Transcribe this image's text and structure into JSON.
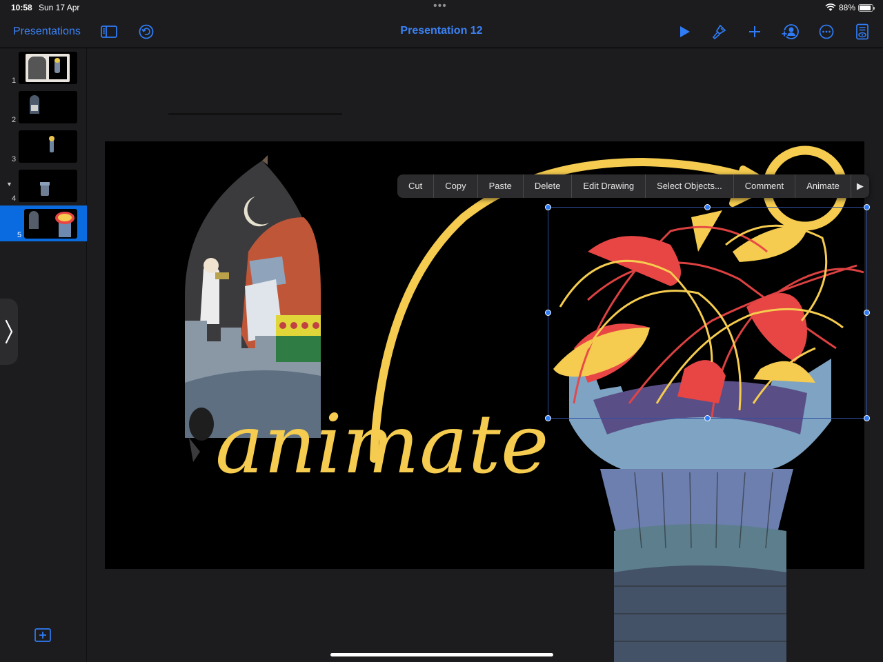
{
  "status": {
    "time": "10:58",
    "date": "Sun 17 Apr",
    "battery": "88%",
    "battery_level": 0.88
  },
  "toolbar": {
    "back_label": "Presentations",
    "title": "Presentation 12",
    "icons": [
      "sidebar-icon",
      "undo-icon",
      "play-icon",
      "format-brush-icon",
      "add-icon",
      "collaborate-icon",
      "more-icon",
      "presenter-notes-icon"
    ]
  },
  "sidebar": {
    "slides": [
      {
        "number": "1"
      },
      {
        "number": "2"
      },
      {
        "number": "3"
      },
      {
        "number": "4"
      },
      {
        "number": "5",
        "selected": true
      }
    ]
  },
  "context_menu": {
    "items": [
      "Cut",
      "Copy",
      "Paste",
      "Delete",
      "Edit Drawing",
      "Select Objects...",
      "Comment",
      "Animate"
    ]
  },
  "slide": {
    "handwriting": "animate"
  },
  "colors": {
    "accent": "#2f7cf6",
    "drawing_yellow": "#f5cc4f",
    "drawing_red": "#e84545",
    "selected_slide": "#0a6be0"
  }
}
